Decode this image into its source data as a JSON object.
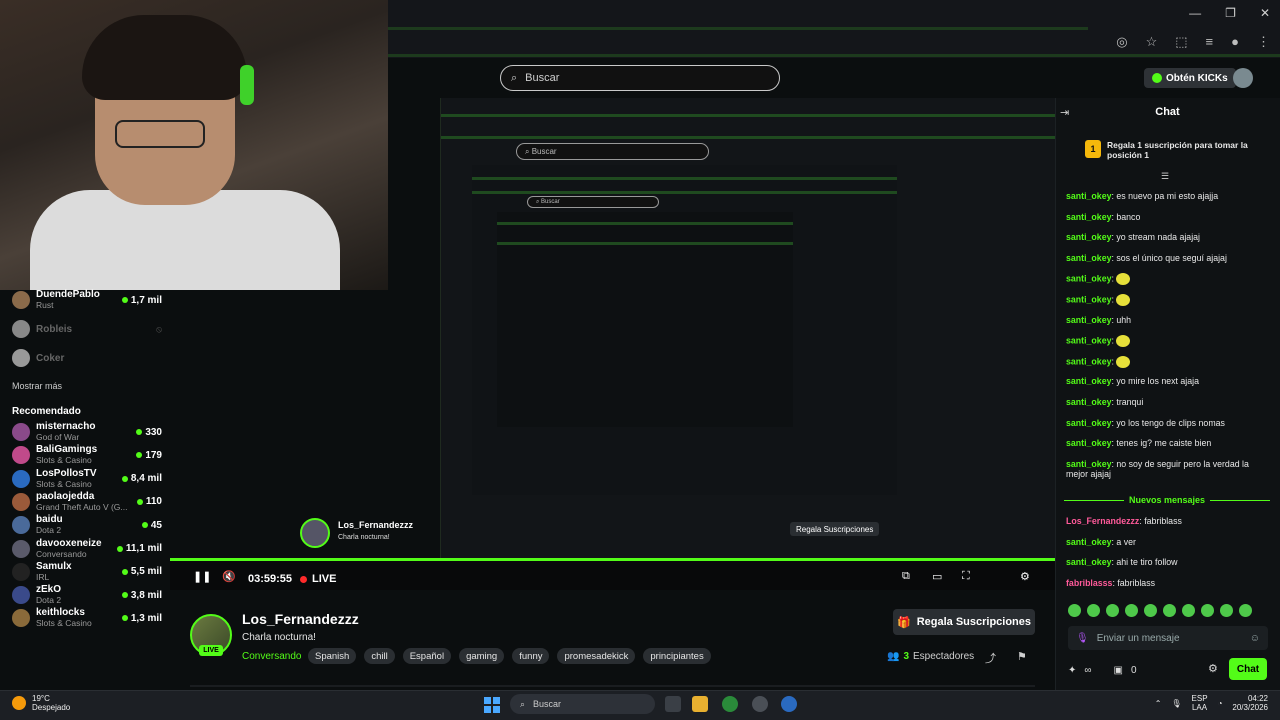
{
  "browser": {
    "search_placeholder": "Buscar",
    "kicks_label": "Obtén KICKs"
  },
  "sidebar": {
    "followed": [
      {
        "name": "DuendePablo",
        "sub": "Rust",
        "count": "1,7 mil",
        "color": "#8a6a4a"
      },
      {
        "name": "Robleis",
        "sub": "",
        "count": "",
        "color": "#888888"
      },
      {
        "name": "Coker",
        "sub": "",
        "count": "",
        "color": "#999999"
      }
    ],
    "show_more": "Mostrar más",
    "recommended_heading": "Recomendado",
    "recommended": [
      {
        "name": "misternacho",
        "sub": "God of War",
        "count": "330",
        "color": "#8a4a8a"
      },
      {
        "name": "BaliGamings",
        "sub": "Slots & Casino",
        "count": "179",
        "color": "#c04a8a"
      },
      {
        "name": "LosPollosTV",
        "sub": "Slots & Casino",
        "count": "8,4 mil",
        "color": "#2a6ac0"
      },
      {
        "name": "paolaojedda",
        "sub": "Grand Theft Auto V (G...",
        "count": "110",
        "color": "#9a5a3a"
      },
      {
        "name": "baidu",
        "sub": "Dota 2",
        "count": "45",
        "color": "#4a6a9a"
      },
      {
        "name": "davooxeneize",
        "sub": "Conversando",
        "count": "11,1 mil",
        "color": "#5a5a6a"
      },
      {
        "name": "Samulx",
        "sub": "IRL",
        "count": "5,5 mil",
        "color": "#222222"
      },
      {
        "name": "zEkO",
        "sub": "Dota 2",
        "count": "3,8 mil",
        "color": "#3a4a8a"
      },
      {
        "name": "keithlocks",
        "sub": "Slots & Casino",
        "count": "1,3 mil",
        "color": "#8a6a3a"
      }
    ]
  },
  "player": {
    "time": "03:59:55",
    "live_label": "LIVE"
  },
  "stream": {
    "streamer": "Los_Fernandezzz",
    "title": "Charla nocturna!",
    "category": "Conversando",
    "tags": [
      "Spanish",
      "chill",
      "Español",
      "gaming",
      "funny",
      "promesadekick",
      "principiantes"
    ],
    "live_badge": "LIVE",
    "subs_button": "Regala Suscripciones",
    "viewers_count": "3",
    "viewers_label": "Espectadores"
  },
  "chat": {
    "title": "Chat",
    "pinned_rank": "1",
    "pinned_text": "Regala 1 suscripción para tomar la posición 1",
    "messages": [
      {
        "user": "santi_okey",
        "text": "es nuevo pa mi esto ajajja",
        "emote": false
      },
      {
        "user": "santi_okey",
        "text": "banco",
        "emote": false
      },
      {
        "user": "santi_okey",
        "text": "yo stream nada ajajaj",
        "emote": false
      },
      {
        "user": "santi_okey",
        "text": "sos el único que seguí ajajaj",
        "emote": false
      },
      {
        "user": "santi_okey",
        "text": "",
        "emote": true
      },
      {
        "user": "santi_okey",
        "text": "",
        "emote": true
      },
      {
        "user": "santi_okey",
        "text": "uhh",
        "emote": false
      },
      {
        "user": "santi_okey",
        "text": "",
        "emote": true
      },
      {
        "user": "santi_okey",
        "text": "",
        "emote": true
      },
      {
        "user": "santi_okey",
        "text": "yo mire los next ajaja",
        "emote": false
      },
      {
        "user": "santi_okey",
        "text": "tranqui",
        "emote": false
      },
      {
        "user": "santi_okey",
        "text": "yo los tengo de clips nomas",
        "emote": false
      },
      {
        "user": "santi_okey",
        "text": "tenes ig? me caiste bien",
        "emote": false
      },
      {
        "user": "santi_okey",
        "text": "no soy de seguir pero la verdad la mejor ajajaj",
        "emote": false
      }
    ],
    "new_messages_label": "Nuevos mensajes",
    "new_messages": [
      {
        "user": "Los_Fernandezzz",
        "text": "fabriblass",
        "pink": true
      },
      {
        "user": "santi_okey",
        "text": "a ver",
        "pink": false
      },
      {
        "user": "santi_okey",
        "text": "ahi te tiro follow",
        "pink": false
      },
      {
        "user": "fabriblasss",
        "text": "fabriblass",
        "pink": true
      }
    ],
    "input_placeholder": "Enviar un mensaje",
    "points": "∞",
    "gifts": "0",
    "send_label": "Chat"
  },
  "taskbar": {
    "temp": "19°C",
    "weather": "Despejado",
    "search_placeholder": "Buscar",
    "lang1": "ESP",
    "lang2": "LAA",
    "time": "04:22",
    "date": "20/3/2026"
  }
}
